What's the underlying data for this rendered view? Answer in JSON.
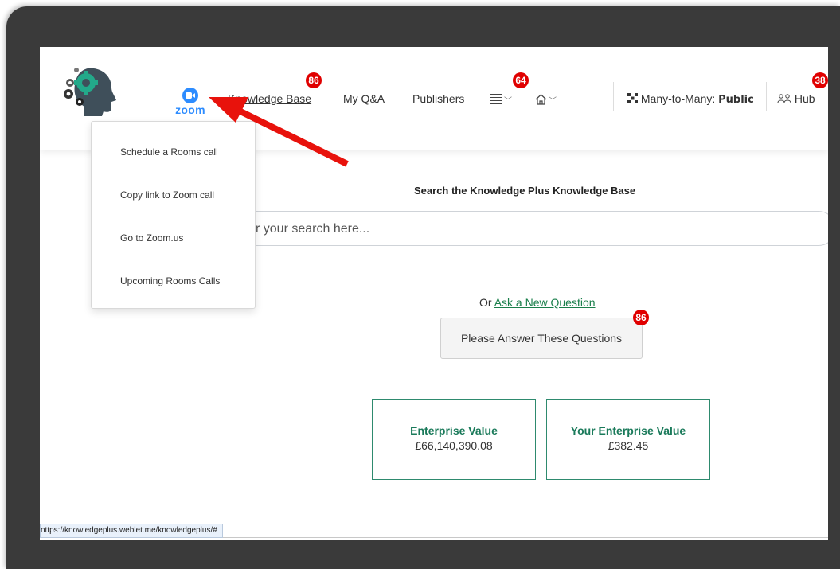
{
  "nav": {
    "zoom_label": "zoom",
    "knowledge_base": "Knowledge Base",
    "knowledge_base_badge": "86",
    "my_qa": "My Q&A",
    "publishers": "Publishers",
    "grid_badge": "64",
    "many_to_many_label": "Many-to-Many:",
    "many_to_many_value": "Public",
    "hub": "Hub",
    "hub_badge": "38"
  },
  "zoom_menu": {
    "items": [
      "Schedule a Rooms call",
      "Copy link to Zoom call",
      "Go to Zoom.us",
      "Upcoming Rooms Calls"
    ]
  },
  "search": {
    "title": "Search the Knowledge Plus Knowledge Base",
    "placeholder_visible": "r your search here..."
  },
  "ask": {
    "prefix": "Or",
    "link": "Ask a New Question"
  },
  "answer_button": {
    "label": "Please Answer These Questions",
    "badge": "86"
  },
  "cards": [
    {
      "title": "Enterprise Value",
      "value": "£66,140,390.08"
    },
    {
      "title": "Your Enterprise Value",
      "value": "£382.45"
    }
  ],
  "status_bar": {
    "url": "nttps://knowledgeplus.weblet.me/knowledgeplus/#"
  },
  "colors": {
    "badge": "#e00000",
    "zoom_blue": "#2d8cff",
    "card_green": "#1a7a5a",
    "annotation_arrow": "#e8120c"
  }
}
